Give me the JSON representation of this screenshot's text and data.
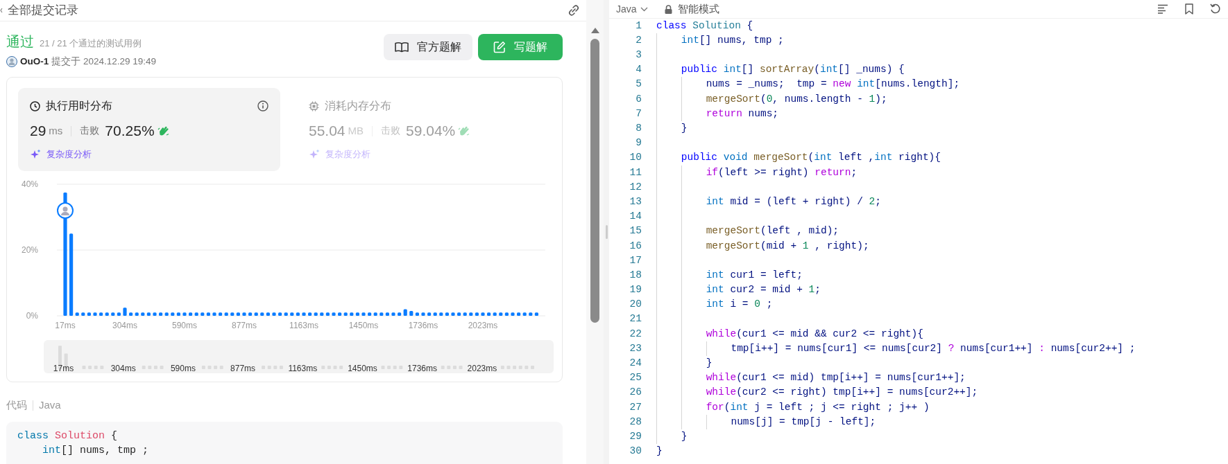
{
  "header": {
    "title": "全部提交记录"
  },
  "result": {
    "status": "通过",
    "passed": "21 / 21 个通过的测试用例",
    "user": "OuO-1",
    "submitted": "提交于 2024.12.29 19:49"
  },
  "buttons": [
    {
      "label": "官方题解",
      "kind": "secondary"
    },
    {
      "label": "写题解",
      "kind": "primary"
    }
  ],
  "stat_cards": [
    {
      "kind": "time",
      "title": "执行用时分布",
      "value": "29",
      "unit": "ms",
      "beat_label": "击败",
      "percent": "70.25%",
      "analysis": "复杂度分析",
      "selected": true
    },
    {
      "kind": "memory",
      "title": "消耗内存分布",
      "value": "55.04",
      "unit": "MB",
      "beat_label": "击败",
      "percent": "59.04%",
      "analysis": "复杂度分析",
      "selected": false
    }
  ],
  "distribution": {
    "chart_data": {
      "type": "bar",
      "ylim": [
        0,
        40
      ],
      "yticks": [
        {
          "value": 0,
          "label": "0%"
        },
        {
          "value": 20,
          "label": "20%"
        },
        {
          "value": 40,
          "label": "40%"
        }
      ],
      "categories": [
        "17ms",
        null,
        null,
        null,
        null,
        null,
        null,
        null,
        null,
        null,
        "304ms",
        null,
        null,
        null,
        null,
        null,
        null,
        null,
        null,
        null,
        "590ms",
        null,
        null,
        null,
        null,
        null,
        null,
        null,
        null,
        null,
        "877ms",
        null,
        null,
        null,
        null,
        null,
        null,
        null,
        null,
        null,
        "1163ms",
        null,
        null,
        null,
        null,
        null,
        null,
        null,
        null,
        null,
        "1450ms",
        null,
        null,
        null,
        null,
        null,
        null,
        null,
        null,
        null,
        "1736ms",
        null,
        null,
        null,
        null,
        null,
        null,
        null,
        null,
        null,
        "2023ms",
        null,
        null,
        null,
        null,
        null,
        null,
        null,
        null,
        null
      ],
      "values": [
        37.5,
        25,
        1,
        1,
        1,
        1,
        1,
        1,
        1,
        1,
        2.5,
        1,
        1,
        1,
        1,
        1,
        1,
        1,
        1,
        1,
        1,
        1,
        1,
        1,
        1,
        1,
        1,
        1,
        1,
        1,
        1,
        1,
        1,
        1,
        1,
        1,
        1,
        1,
        1,
        1,
        1,
        1,
        1,
        1,
        1,
        1,
        1,
        1,
        1,
        1,
        1,
        1,
        1,
        1,
        1,
        1,
        1,
        2,
        1.5,
        1,
        1,
        1,
        1,
        1,
        1,
        1,
        1,
        1,
        1,
        1,
        1,
        1,
        1,
        1,
        1,
        1,
        1,
        1,
        1,
        1
      ]
    },
    "overview_labels": [
      "17ms",
      "304ms",
      "590ms",
      "877ms",
      "1163ms",
      "1450ms",
      "1736ms",
      "2023ms"
    ]
  },
  "code_section": {
    "title": "代码",
    "language": "Java",
    "lines": [
      {
        "tokens": [
          {
            "kind": "kw",
            "text": "class"
          },
          {
            "kind": "cls",
            "text": " Solution"
          },
          {
            "kind": "p",
            "text": " {"
          }
        ]
      },
      {
        "tokens": [
          {
            "kind": "ty",
            "text": "    int"
          },
          {
            "kind": "p",
            "text": "[] nums, tmp ;"
          }
        ]
      }
    ]
  },
  "editor": {
    "language": "Java",
    "mode": "智能模式",
    "lines": [
      {
        "number": "1",
        "tokens": [
          {
            "kind": "kw",
            "text": "class"
          },
          {
            "kind": "cls",
            "text": " Solution"
          },
          {
            "kind": "p",
            "text": " {"
          }
        ]
      },
      {
        "number": "2",
        "tokens": [
          {
            "kind": "ty",
            "text": "    int"
          },
          {
            "kind": "p",
            "text": "[] nums, tmp ;"
          }
        ]
      },
      {
        "number": "3"
      },
      {
        "number": "4",
        "tokens": [
          {
            "kind": "kw",
            "text": "    public"
          },
          {
            "kind": "ty",
            "text": " int"
          },
          {
            "kind": "p",
            "text": "[]"
          },
          {
            "kind": "fn",
            "text": " sortArray"
          },
          {
            "kind": "p",
            "text": "("
          },
          {
            "kind": "ty",
            "text": "int"
          },
          {
            "kind": "p",
            "text": "[] _nums) {"
          }
        ]
      },
      {
        "number": "5",
        "tokens": [
          {
            "kind": "p",
            "text": "        nums = _nums;  tmp ="
          },
          {
            "kind": "ct",
            "text": " new"
          },
          {
            "kind": "ty",
            "text": " int"
          },
          {
            "kind": "p",
            "text": "[nums.length];"
          }
        ]
      },
      {
        "number": "6",
        "tokens": [
          {
            "kind": "fn",
            "text": "        mergeSort"
          },
          {
            "kind": "p",
            "text": "("
          },
          {
            "kind": "num",
            "text": "0"
          },
          {
            "kind": "p",
            "text": ", nums.length -"
          },
          {
            "kind": "num",
            "text": " 1"
          },
          {
            "kind": "p",
            "text": ");"
          }
        ]
      },
      {
        "number": "7",
        "tokens": [
          {
            "kind": "ct",
            "text": "        return"
          },
          {
            "kind": "p",
            "text": " nums;"
          }
        ]
      },
      {
        "number": "8",
        "tokens": [
          {
            "kind": "p",
            "text": "    }"
          }
        ]
      },
      {
        "number": "9"
      },
      {
        "number": "10",
        "tokens": [
          {
            "kind": "kw",
            "text": "    public"
          },
          {
            "kind": "ty",
            "text": " void"
          },
          {
            "kind": "fn",
            "text": " mergeSort"
          },
          {
            "kind": "p",
            "text": "("
          },
          {
            "kind": "ty",
            "text": "int"
          },
          {
            "kind": "p",
            "text": " left ,"
          },
          {
            "kind": "ty",
            "text": "int"
          },
          {
            "kind": "p",
            "text": " right){"
          }
        ]
      },
      {
        "number": "11",
        "tokens": [
          {
            "kind": "ct",
            "text": "        if"
          },
          {
            "kind": "p",
            "text": "(left >= right)"
          },
          {
            "kind": "ct",
            "text": " return"
          },
          {
            "kind": "p",
            "text": ";"
          }
        ]
      },
      {
        "number": "12"
      },
      {
        "number": "13",
        "tokens": [
          {
            "kind": "ty",
            "text": "        int"
          },
          {
            "kind": "p",
            "text": " mid = (left + right) /"
          },
          {
            "kind": "num",
            "text": " 2"
          },
          {
            "kind": "p",
            "text": ";"
          }
        ]
      },
      {
        "number": "14"
      },
      {
        "number": "15",
        "tokens": [
          {
            "kind": "fn",
            "text": "        mergeSort"
          },
          {
            "kind": "p",
            "text": "(left , mid);"
          }
        ]
      },
      {
        "number": "16",
        "tokens": [
          {
            "kind": "fn",
            "text": "        mergeSort"
          },
          {
            "kind": "p",
            "text": "(mid +"
          },
          {
            "kind": "num",
            "text": " 1"
          },
          {
            "kind": "p",
            "text": " , right);"
          }
        ]
      },
      {
        "number": "17"
      },
      {
        "number": "18",
        "tokens": [
          {
            "kind": "ty",
            "text": "        int"
          },
          {
            "kind": "p",
            "text": " cur1 = left;"
          }
        ]
      },
      {
        "number": "19",
        "tokens": [
          {
            "kind": "ty",
            "text": "        int"
          },
          {
            "kind": "p",
            "text": " cur2 = mid +"
          },
          {
            "kind": "num",
            "text": " 1"
          },
          {
            "kind": "p",
            "text": ";"
          }
        ]
      },
      {
        "number": "20",
        "tokens": [
          {
            "kind": "ty",
            "text": "        int"
          },
          {
            "kind": "p",
            "text": " i ="
          },
          {
            "kind": "num",
            "text": " 0"
          },
          {
            "kind": "p",
            "text": " ;"
          }
        ]
      },
      {
        "number": "21"
      },
      {
        "number": "22",
        "tokens": [
          {
            "kind": "ct",
            "text": "        while"
          },
          {
            "kind": "p",
            "text": "(cur1 <= mid && cur2 <= right){"
          }
        ]
      },
      {
        "number": "23",
        "tokens": [
          {
            "kind": "p",
            "text": "            tmp[i++] = nums[cur1] <= nums[cur2]"
          },
          {
            "kind": "ct",
            "text": " ?"
          },
          {
            "kind": "p",
            "text": " nums[cur1++]"
          },
          {
            "kind": "ct",
            "text": " :"
          },
          {
            "kind": "p",
            "text": " nums[cur2++] ;"
          }
        ]
      },
      {
        "number": "24",
        "tokens": [
          {
            "kind": "p",
            "text": "        }"
          }
        ]
      },
      {
        "number": "25",
        "tokens": [
          {
            "kind": "ct",
            "text": "        while"
          },
          {
            "kind": "p",
            "text": "(cur1 <= mid) tmp[i++] = nums[cur1++];"
          }
        ]
      },
      {
        "number": "26",
        "tokens": [
          {
            "kind": "ct",
            "text": "        while"
          },
          {
            "kind": "p",
            "text": "(cur2 <= right) tmp[i++] = nums[cur2++];"
          }
        ]
      },
      {
        "number": "27",
        "tokens": [
          {
            "kind": "ct",
            "text": "        for"
          },
          {
            "kind": "p",
            "text": "("
          },
          {
            "kind": "ty",
            "text": "int"
          },
          {
            "kind": "p",
            "text": " j = left ; j <= right ; j++ )"
          }
        ]
      },
      {
        "number": "28",
        "tokens": [
          {
            "kind": "p",
            "text": "            nums[j] = tmp[j - left];"
          }
        ]
      },
      {
        "number": "29",
        "tokens": [
          {
            "kind": "p",
            "text": "    }"
          }
        ]
      },
      {
        "number": "30",
        "tokens": [
          {
            "kind": "p",
            "text": "}"
          }
        ]
      }
    ]
  }
}
